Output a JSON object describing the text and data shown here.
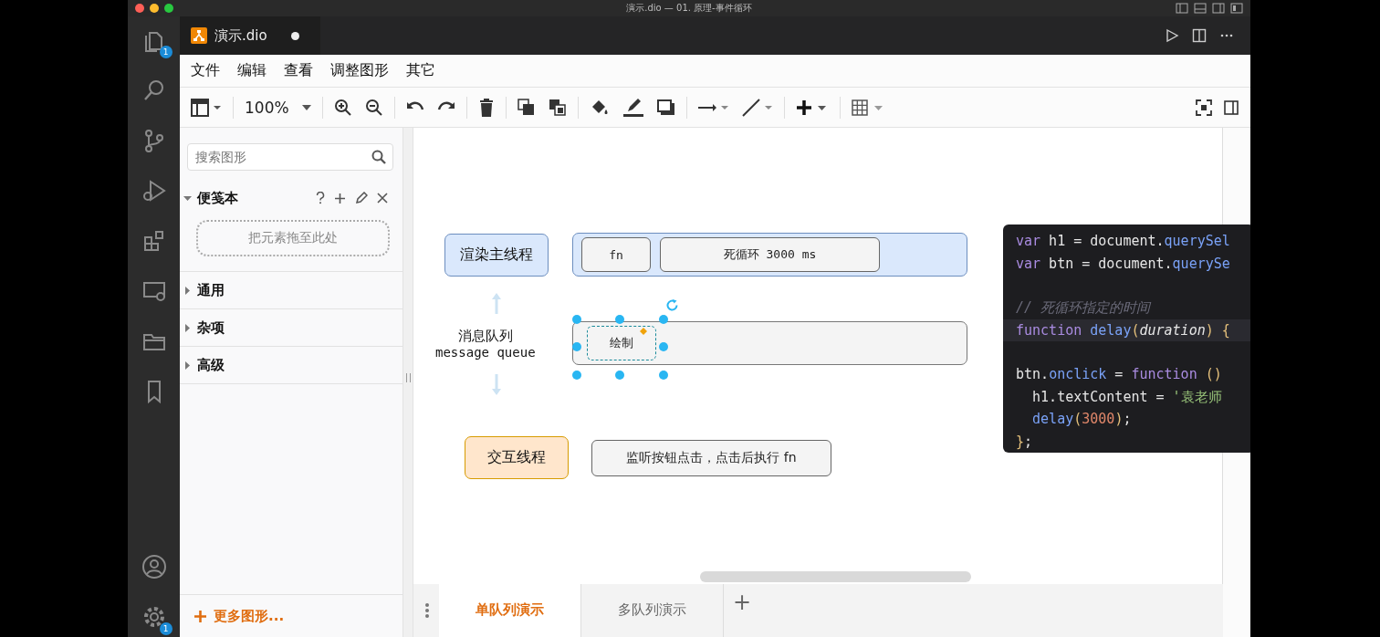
{
  "window": {
    "title": "演示.dio — 01. 原理-事件循环"
  },
  "activity_bar": {
    "explorer_badge": "1",
    "settings_badge": "1"
  },
  "editor_tab": {
    "title": "演示.dio",
    "modified": true
  },
  "menu": [
    "文件",
    "编辑",
    "查看",
    "调整图形",
    "其它"
  ],
  "toolbar": {
    "zoom": "100%"
  },
  "sidebar": {
    "search": {
      "placeholder": "搜索图形"
    },
    "sections": [
      {
        "label": "便笺本",
        "expanded": true,
        "drop_hint": "把元素拖至此处"
      },
      {
        "label": "通用",
        "expanded": false
      },
      {
        "label": "杂项",
        "expanded": false
      },
      {
        "label": "高级",
        "expanded": false
      }
    ],
    "more_shapes": "更多图形..."
  },
  "diagram": {
    "rows": [
      {
        "kind": "thread",
        "label": "渲染主线程",
        "color": "#dae8fc",
        "lane": true,
        "tasks": [
          {
            "text": "fn",
            "selected": false
          },
          {
            "text": "死循环 3000 ms",
            "selected": false
          }
        ]
      },
      {
        "kind": "queue",
        "label": "消息队列",
        "sublabel": "message queue",
        "lane": true,
        "tasks": [
          {
            "text": "绘制",
            "selected": true
          }
        ]
      },
      {
        "kind": "thread",
        "label": "交互线程",
        "color": "#ffe6cc",
        "lane": false,
        "tasks": [
          {
            "text": "监听按钮点击，点击后执行 fn",
            "selected": false
          }
        ]
      }
    ]
  },
  "code": {
    "blocks": [
      [
        {
          "highlighted": false,
          "tokens": [
            {
              "kind": "keyword",
              "text": "var"
            },
            {
              "kind": "plain",
              "text": " h1 = document."
            },
            {
              "kind": "method",
              "text": "querySel"
            }
          ]
        },
        {
          "highlighted": false,
          "tokens": [
            {
              "kind": "keyword",
              "text": "var"
            },
            {
              "kind": "plain",
              "text": " btn = document."
            },
            {
              "kind": "method",
              "text": "querySe"
            }
          ]
        }
      ],
      [
        {
          "highlighted": false,
          "tokens": [
            {
              "kind": "comment",
              "text": "// 死循环指定的时间"
            }
          ]
        },
        {
          "highlighted": true,
          "tokens": [
            {
              "kind": "keyword",
              "text": "function"
            },
            {
              "kind": "method",
              "text": " delay"
            },
            {
              "kind": "bracket",
              "text": "("
            },
            {
              "kind": "param",
              "text": "duration"
            },
            {
              "kind": "bracket",
              "text": ") {"
            }
          ]
        }
      ],
      [
        {
          "highlighted": false,
          "tokens": [
            {
              "kind": "plain",
              "text": "btn."
            },
            {
              "kind": "method",
              "text": "onclick"
            },
            {
              "kind": "plain",
              "text": " = "
            },
            {
              "kind": "keyword",
              "text": "function"
            },
            {
              "kind": "bracket",
              "text": " ()"
            }
          ]
        },
        {
          "highlighted": false,
          "tokens": [
            {
              "kind": "plain",
              "text": "  h1.textContent = "
            },
            {
              "kind": "string",
              "text": "'袁老师"
            }
          ]
        },
        {
          "highlighted": false,
          "tokens": [
            {
              "kind": "method",
              "text": "  delay"
            },
            {
              "kind": "bracket",
              "text": "("
            },
            {
              "kind": "number",
              "text": "3000"
            },
            {
              "kind": "bracket",
              "text": ")"
            },
            {
              "kind": "plain",
              "text": ";"
            }
          ]
        },
        {
          "highlighted": false,
          "tokens": [
            {
              "kind": "bracket",
              "text": "}"
            },
            {
              "kind": "plain",
              "text": ";"
            }
          ]
        }
      ]
    ]
  },
  "pages": [
    {
      "label": "单队列演示",
      "selected": true
    },
    {
      "label": "多队列演示",
      "selected": false
    }
  ],
  "add_page": "+"
}
